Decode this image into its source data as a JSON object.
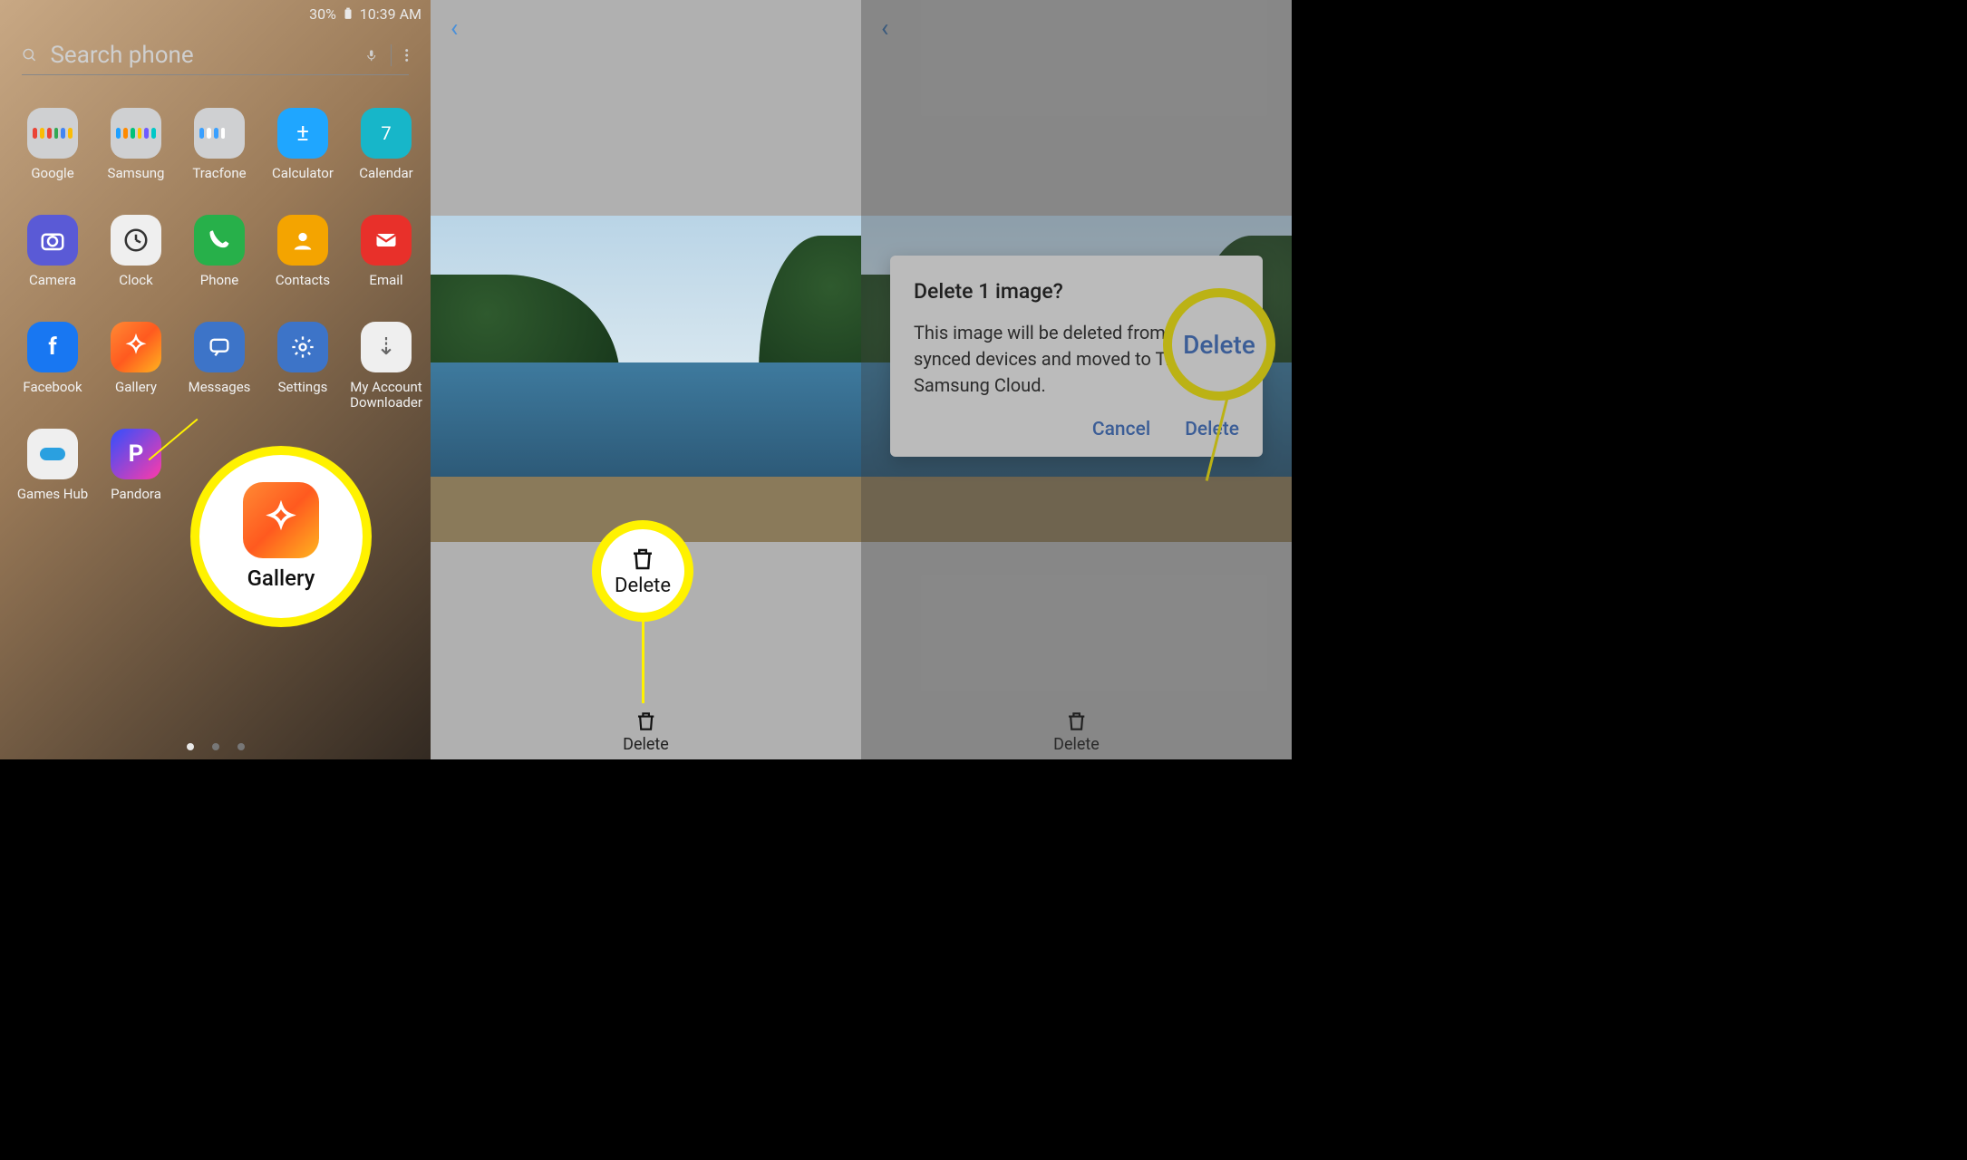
{
  "statusbar": {
    "battery_pct": "30%",
    "time": "10:39 AM"
  },
  "search": {
    "placeholder": "Search phone"
  },
  "apps": {
    "google": "Google",
    "samsung": "Samsung",
    "tracfone": "Tracfone",
    "calculator": "Calculator",
    "calendar": "Calendar",
    "camera": "Camera",
    "clock": "Clock",
    "phone": "Phone",
    "contacts": "Contacts",
    "email": "Email",
    "facebook": "Facebook",
    "gallery": "Gallery",
    "messages": "Messages",
    "settings": "Settings",
    "my_account": "My Account Downloader",
    "games_hub": "Games Hub",
    "pandora": "Pandora"
  },
  "highlight": {
    "gallery_label": "Gallery",
    "delete_label": "Delete",
    "delete_big": "Delete"
  },
  "bottom_action": {
    "delete": "Delete"
  },
  "dialog": {
    "title": "Delete 1 image?",
    "body": "This image will be deleted from your synced devices and moved to Trash in Samsung Cloud.",
    "cancel": "Cancel",
    "delete": "Delete"
  }
}
